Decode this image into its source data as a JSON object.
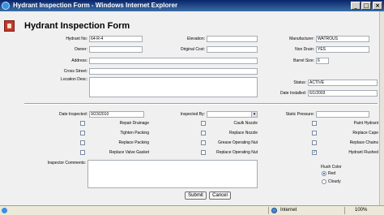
{
  "window": {
    "title": "Hydrant Inspection Form - Windows Internet Explorer",
    "minimize": "_",
    "maximize": "□",
    "close": "×"
  },
  "form": {
    "title": "Hydrant Inspection Form",
    "labels": {
      "hydrant_no": "Hydrant No:",
      "owner": "Owner:",
      "address": "Address:",
      "cross_street": "Cross Street:",
      "location_desc": "Location Desc:",
      "elevation": "Elevation:",
      "original_cost": "Original Cost:",
      "manufacturer": "Manufacturer:",
      "non_drain": "Non Drain:",
      "barrel_size": "Barrel Size:",
      "status": "Status:",
      "date_installed": "Date Installed:",
      "date_inspected": "Date Inspected:",
      "inspected_by": "Inspected By:",
      "static_pressure": "Static Pressure:",
      "inspector_comments": "Inspector Comments:",
      "flush_color": "Flush Color"
    },
    "values": {
      "hydrant_no": "64-R-4",
      "manufacturer": "WATROUS",
      "non_drain": "YES",
      "barrel_size": "6",
      "status": "ACTIVE",
      "date_installed": "6/1/2003",
      "date_inspected": "9/23/2010"
    },
    "checkboxes": {
      "col1": [
        {
          "label": "Repair Drainage",
          "checked": false
        },
        {
          "label": "Tighten Packing",
          "checked": false
        },
        {
          "label": "Replace Packing",
          "checked": false
        },
        {
          "label": "Replace Valve Gasket",
          "checked": false
        }
      ],
      "col2": [
        {
          "label": "Caulk Nozzle",
          "checked": false
        },
        {
          "label": "Replace Nozzle",
          "checked": false
        },
        {
          "label": "Grease Operating Nut",
          "checked": false
        },
        {
          "label": "Replace Operating Nut",
          "checked": false
        }
      ],
      "col3": [
        {
          "label": "Paint Hydrant",
          "checked": false
        },
        {
          "label": "Replace Cape",
          "checked": false
        },
        {
          "label": "Replace Chains",
          "checked": false
        },
        {
          "label": "Hydrant Flushed",
          "checked": true
        }
      ]
    },
    "flush_options": [
      {
        "label": "Red",
        "selected": true
      },
      {
        "label": "Cloudy",
        "selected": false
      }
    ],
    "submit_label": "Submit",
    "cancel_label": "Cancel",
    "checkmark": "✓"
  },
  "statusbar": {
    "zone": "Internet",
    "zoom": "100%"
  }
}
